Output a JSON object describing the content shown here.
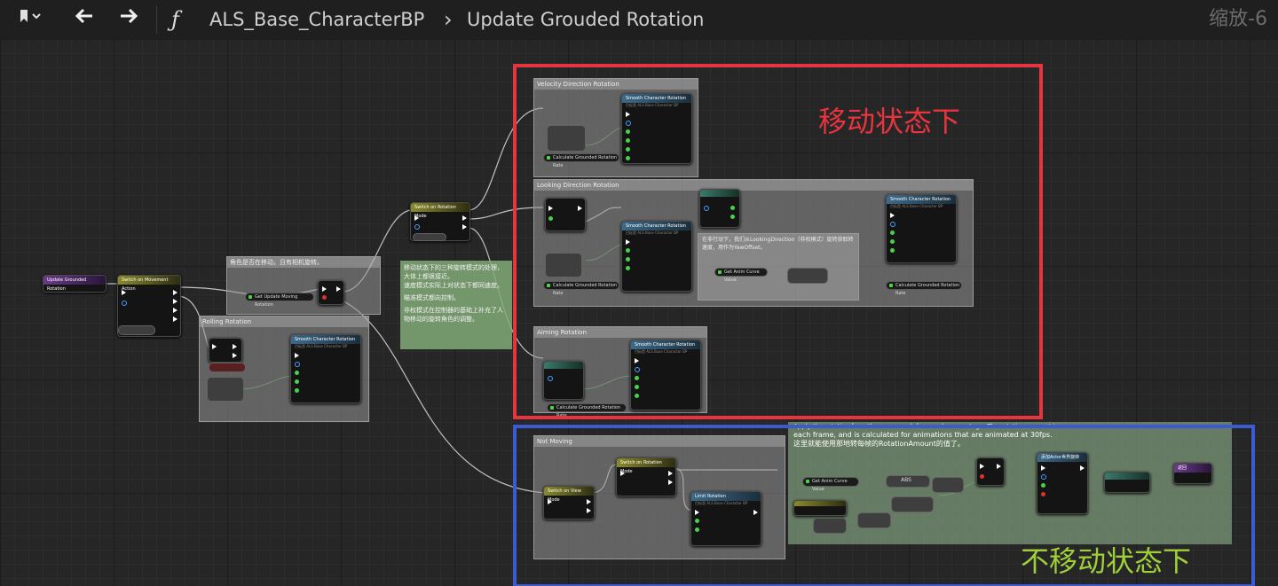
{
  "toolbar": {
    "bookmark_icon": "bookmark-icon",
    "back_icon": "arrow-left-icon",
    "forward_icon": "arrow-right-icon",
    "function_symbol": "ƒ",
    "breadcrumb_parent": "ALS_Base_CharacterBP",
    "breadcrumb_separator": "›",
    "breadcrumb_current": "Update Grouded Rotation",
    "zoom": "缩放-6"
  },
  "graph": {
    "entry_node": "Update Grounded Rotation",
    "switch_movement_state": "Switch on Movement Action",
    "rolling_comment": "Rolling Rotation",
    "moving_check_comment": "角色是否在移动，且有相机旋转。",
    "get_update_moving_rotation": "Get Update Moving Rotation",
    "note_rotation_modes": [
      "移动状态下的三种旋转模式的处理，大体上都很接近。",
      "速度模式实际上对状态下都同速度。",
      "瞄准模式都向控制。",
      "非权模式在控制器的基础上补充了人物移动的旋转角色的调整。"
    ],
    "switch_rotation_mode": "Switch on Rotation Mode",
    "velocity_comment": "Velocity Direction Rotation",
    "looking_comment": "Looking Direction Rotation",
    "aiming_comment": "Aiming Rotation",
    "not_moving_comment": "Not Moving",
    "smooth_rotation": "Smooth Character Rotation",
    "smooth_target": "目标是 ALS Base Character BP",
    "calc_rotation_rate": "Calculate Grounded Rotation Rate",
    "get_anim_curve": "Get Anim Curve Value",
    "looking_note": "在非行动下，我们从LookingDirection（非权模式）旋转获取转速度，用作为YawOffset。",
    "limit_rotation": "Limit Rotation",
    "switch_view_mode": "Switch on View Mode",
    "abs_label": "ABS",
    "not_moving_note_1": "Apply the rotation from the curve each frame when montage. The rotation amount is",
    "not_moving_note_2": "each frame, and is calculated for animations that are animated at 30fps.",
    "not_moving_note_3": "这里就能使用那地转每帧的RotationAmount的值了。",
    "add_actor_world_rotation": "添加Actor世界旋转",
    "return_node": "返回"
  },
  "annotations": {
    "moving_label": "移动状态下",
    "not_moving_label": "不移动状态下",
    "moving_color": "#e8343e",
    "not_moving_color": "#3b5bd0",
    "moving_text_color": "#e8343e",
    "not_moving_text_color": "#9fd03a"
  }
}
